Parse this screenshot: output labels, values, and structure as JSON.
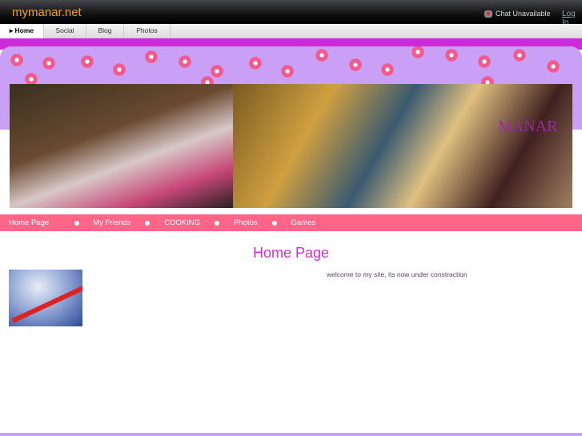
{
  "header": {
    "site_name": "mymanar.net",
    "chat_status": "Chat Unavailable",
    "login": "Log In"
  },
  "tabs": [
    {
      "label": "Home",
      "active": true
    },
    {
      "label": "Social"
    },
    {
      "label": "Blog"
    },
    {
      "label": "Photos"
    }
  ],
  "banner": {
    "title": "MANAR"
  },
  "nav": [
    "Home Page",
    "My Friends",
    "COOKING",
    "Photos",
    "Games"
  ],
  "main": {
    "heading": "Home Page",
    "welcome": "welcome to my site, its now under constraction"
  }
}
